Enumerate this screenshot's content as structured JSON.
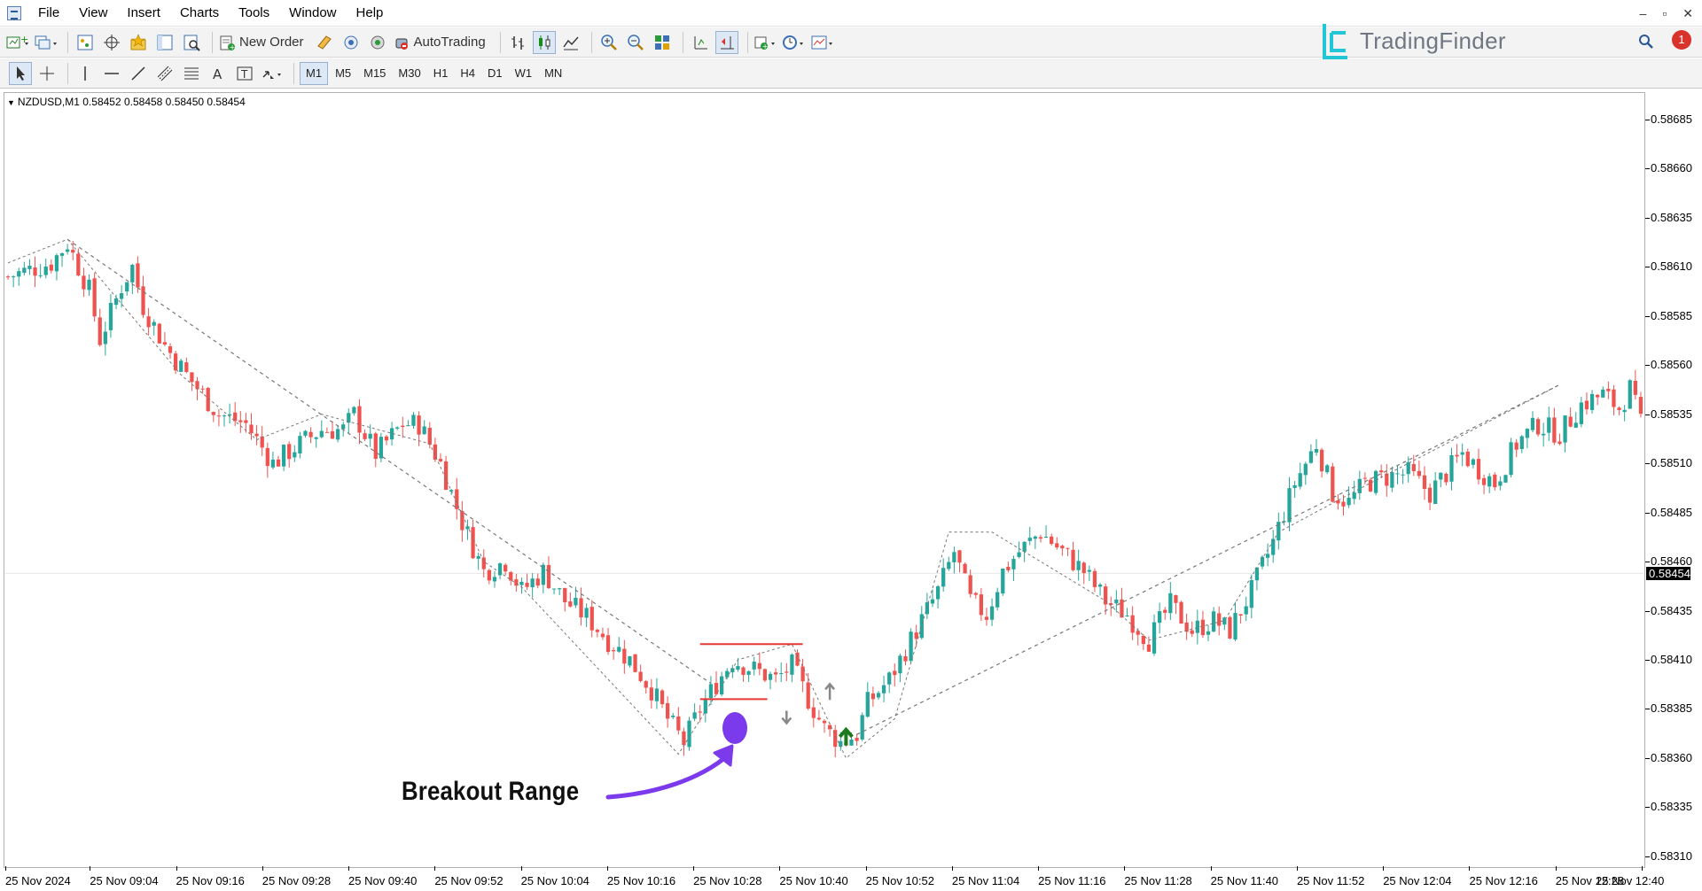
{
  "menu": {
    "items": [
      "File",
      "View",
      "Insert",
      "Charts",
      "Tools",
      "Window",
      "Help"
    ]
  },
  "window_controls": [
    "–",
    "▫",
    "✕"
  ],
  "toolbar": {
    "new_order_label": "New Order",
    "autotrading_label": "AutoTrading",
    "notification_count": "1"
  },
  "timeframes": [
    "M1",
    "M5",
    "M15",
    "M30",
    "H1",
    "H4",
    "D1",
    "W1",
    "MN"
  ],
  "active_timeframe": "M1",
  "logo": {
    "text": "TradingFinder"
  },
  "chart": {
    "header": "NZDUSD,M1  0.58452 0.58458 0.58450 0.58454",
    "current_price": "0.58454",
    "annotation": "Breakout Range",
    "colors": {
      "bull": "#26a69a",
      "bear": "#ef5350",
      "zigzag": "#777777",
      "range": "#e53935",
      "annotation": "#7c3aed",
      "up_arrow": "#1b7a1b",
      "signal_arrow": "#888888"
    }
  },
  "chart_data": {
    "type": "candlestick",
    "symbol": "NZDUSD",
    "timeframe": "M1",
    "ohlc_header": {
      "open": 0.58452,
      "high": 0.58458,
      "low": 0.5845,
      "close": 0.58454
    },
    "price_ticks": [
      "0.58685",
      "0.58660",
      "0.58635",
      "0.58610",
      "0.58585",
      "0.58560",
      "0.58535",
      "0.58510",
      "0.58485",
      "0.58460",
      "0.58435",
      "0.58410",
      "0.58385",
      "0.58360",
      "0.58335",
      "0.58310"
    ],
    "ylim": [
      0.58305,
      0.58698
    ],
    "time_ticks": [
      "25 Nov 2024",
      "25 Nov 09:04",
      "25 Nov 09:16",
      "25 Nov 09:28",
      "25 Nov 09:40",
      "25 Nov 09:52",
      "25 Nov 10:04",
      "25 Nov 10:16",
      "25 Nov 10:28",
      "25 Nov 10:40",
      "25 Nov 10:52",
      "25 Nov 11:04",
      "25 Nov 11:16",
      "25 Nov 11:28",
      "25 Nov 11:40",
      "25 Nov 11:52",
      "25 Nov 12:04",
      "25 Nov 12:16",
      "25 Nov 12:28",
      "25 Nov 12:40"
    ],
    "price_path": [
      [
        0,
        0.58605
      ],
      [
        8,
        0.58612
      ],
      [
        11,
        0.58622
      ],
      [
        15,
        0.58598
      ],
      [
        17,
        0.58573
      ],
      [
        21,
        0.586
      ],
      [
        23,
        0.5861
      ],
      [
        25,
        0.5859
      ],
      [
        29,
        0.5857
      ],
      [
        33,
        0.58555
      ],
      [
        39,
        0.58535
      ],
      [
        44,
        0.5853
      ],
      [
        49,
        0.5851
      ],
      [
        54,
        0.5852
      ],
      [
        58,
        0.58527
      ],
      [
        62,
        0.58527
      ],
      [
        64,
        0.58535
      ],
      [
        68,
        0.58515
      ],
      [
        73,
        0.5853
      ],
      [
        76,
        0.5853
      ],
      [
        80,
        0.5851
      ],
      [
        84,
        0.5848
      ],
      [
        88,
        0.58455
      ],
      [
        92,
        0.5846
      ],
      [
        95,
        0.58445
      ],
      [
        99,
        0.58455
      ],
      [
        103,
        0.5844
      ],
      [
        107,
        0.58432
      ],
      [
        111,
        0.5842
      ],
      [
        115,
        0.5841
      ],
      [
        119,
        0.58395
      ],
      [
        122,
        0.5838
      ],
      [
        125,
        0.58368
      ],
      [
        128,
        0.58385
      ],
      [
        131,
        0.58398
      ],
      [
        134,
        0.5841
      ],
      [
        138,
        0.58405
      ],
      [
        142,
        0.584
      ],
      [
        145,
        0.58407
      ],
      [
        148,
        0.5839
      ],
      [
        151,
        0.58375
      ],
      [
        154,
        0.58368
      ],
      [
        157,
        0.58372
      ],
      [
        159,
        0.58388
      ],
      [
        163,
        0.584
      ],
      [
        166,
        0.58415
      ],
      [
        169,
        0.5843
      ],
      [
        172,
        0.58445
      ],
      [
        175,
        0.58465
      ],
      [
        178,
        0.5844
      ],
      [
        181,
        0.58433
      ],
      [
        184,
        0.58455
      ],
      [
        187,
        0.58465
      ],
      [
        191,
        0.58475
      ],
      [
        195,
        0.58465
      ],
      [
        199,
        0.58455
      ],
      [
        203,
        0.5844
      ],
      [
        207,
        0.58433
      ],
      [
        211,
        0.5842
      ],
      [
        215,
        0.58438
      ],
      [
        219,
        0.58425
      ],
      [
        223,
        0.5843
      ],
      [
        226,
        0.58425
      ],
      [
        230,
        0.58445
      ],
      [
        234,
        0.5847
      ],
      [
        238,
        0.585
      ],
      [
        242,
        0.5852
      ],
      [
        245,
        0.58495
      ],
      [
        248,
        0.5849
      ],
      [
        251,
        0.585
      ],
      [
        255,
        0.58503
      ],
      [
        259,
        0.58505
      ],
      [
        263,
        0.58495
      ],
      [
        266,
        0.58505
      ],
      [
        269,
        0.58515
      ],
      [
        272,
        0.58507
      ],
      [
        275,
        0.585
      ],
      [
        279,
        0.5852
      ],
      [
        283,
        0.5853
      ],
      [
        287,
        0.58525
      ],
      [
        291,
        0.5854
      ],
      [
        295,
        0.58545
      ],
      [
        298,
        0.58538
      ],
      [
        300,
        0.58548
      ],
      [
        302,
        0.5853
      ]
    ],
    "zigzag": [
      [
        0,
        0.58612
      ],
      [
        11,
        0.58624
      ],
      [
        32,
        0.58555
      ],
      [
        46,
        0.58522
      ],
      [
        58,
        0.58535
      ],
      [
        78,
        0.5852
      ],
      [
        88,
        0.5846
      ],
      [
        95,
        0.58447
      ],
      [
        124,
        0.58362
      ],
      [
        135,
        0.5841
      ],
      [
        145,
        0.58418
      ],
      [
        155,
        0.5836
      ],
      [
        164,
        0.5838
      ],
      [
        174,
        0.58475
      ],
      [
        182,
        0.58475
      ],
      [
        203,
        0.5844
      ],
      [
        211,
        0.5842
      ],
      [
        225,
        0.5843
      ],
      [
        235,
        0.58475
      ],
      [
        252,
        0.585
      ],
      [
        287,
        0.5855
      ]
    ],
    "dashed_trendlines": [
      {
        "from": [
          11,
          0.58624
        ],
        "to": [
          130,
          0.58398
        ]
      },
      {
        "from": [
          157,
          0.58372
        ],
        "to": [
          287,
          0.5855
        ]
      }
    ],
    "breakout_range": {
      "top": 0.58418,
      "bottom": 0.5839,
      "start": 128,
      "end": 147
    },
    "signals": [
      {
        "type": "sell_arrow",
        "x": 144,
        "price": 0.58385
      },
      {
        "type": "buy_arrow_grey",
        "x": 152,
        "price": 0.58395
      },
      {
        "type": "buy_arrow_green",
        "x": 155,
        "price": 0.5837
      }
    ],
    "num_candles": 303
  }
}
